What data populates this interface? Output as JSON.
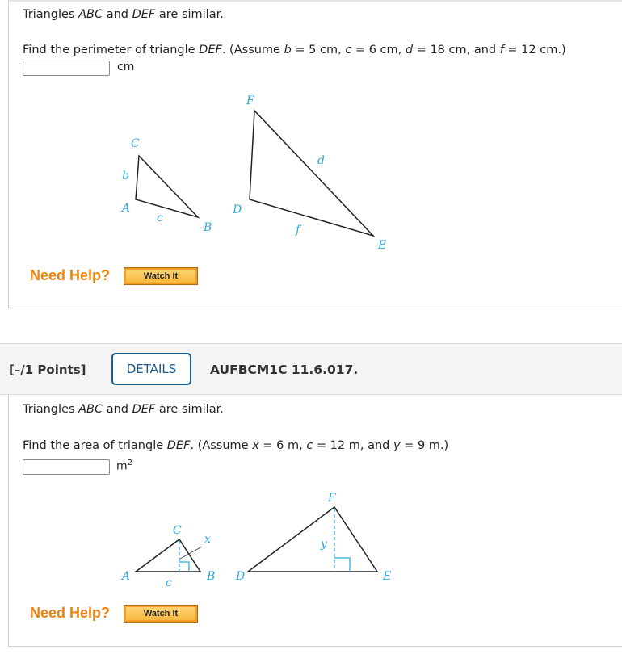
{
  "question1": {
    "intro_parts": [
      "Triangles ",
      "ABC",
      " and ",
      "DEF",
      " are similar."
    ],
    "prompt_parts": [
      "Find the perimeter of triangle ",
      "DEF",
      ". (Assume ",
      "b",
      " = 5 cm, ",
      "c",
      " = 6 cm, ",
      "d",
      " = 18 cm, and ",
      "f",
      " = 12 cm.)"
    ],
    "answer_value": "",
    "unit": "cm",
    "figure_labels": {
      "A": "A",
      "B": "B",
      "C": "C",
      "b": "b",
      "c": "c",
      "D": "D",
      "E": "E",
      "F": "F",
      "d": "d",
      "f": "f"
    },
    "need_help": "Need Help?",
    "watch_it": "Watch It"
  },
  "question2": {
    "points": "[–/1 Points]",
    "details_label": "DETAILS",
    "question_id": "AUFBCM1C 11.6.017.",
    "intro_parts": [
      "Triangles ",
      "ABC",
      " and ",
      "DEF",
      " are similar."
    ],
    "prompt_parts": [
      "Find the area of triangle ",
      "DEF",
      ". (Assume ",
      "x",
      " = 6 m, ",
      "c",
      " = 12 m, and ",
      "y",
      " = 9 m.)"
    ],
    "answer_value": "",
    "unit": "m",
    "unit_sup": "2",
    "figure_labels": {
      "A": "A",
      "B": "B",
      "C": "C",
      "c": "c",
      "x": "x",
      "D": "D",
      "E": "E",
      "F": "F",
      "y": "y"
    },
    "need_help": "Need Help?",
    "watch_it": "Watch It"
  },
  "colors": {
    "accent_orange": "#ee8210",
    "details_blue": "#1a5e8c",
    "figure_label": "#2aa7e0"
  }
}
